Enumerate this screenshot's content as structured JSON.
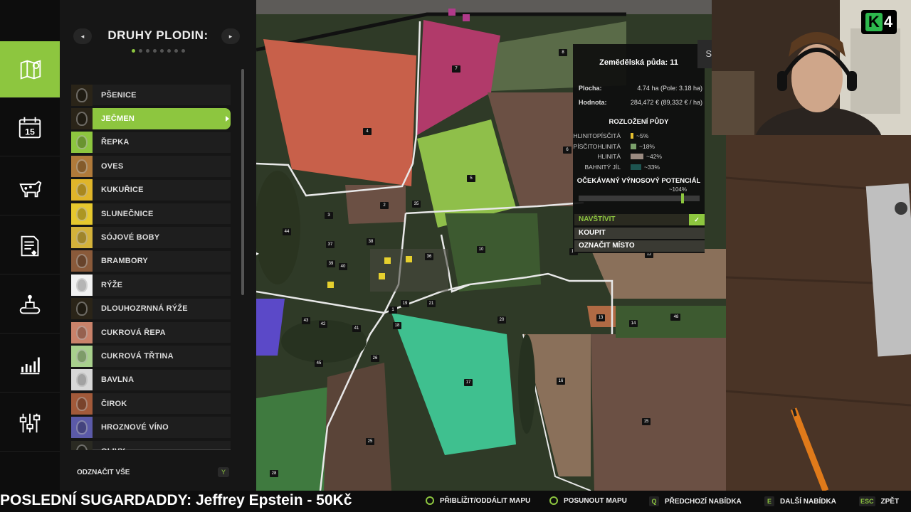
{
  "rail": {
    "items": [
      {
        "name": "map-icon",
        "active": true
      },
      {
        "name": "calendar-icon",
        "day": "15"
      },
      {
        "name": "animals-icon"
      },
      {
        "name": "contracts-icon"
      },
      {
        "name": "production-icon"
      },
      {
        "name": "statistics-icon"
      },
      {
        "name": "settings-icon"
      }
    ]
  },
  "panel": {
    "title": "DRUHY PLODIN:",
    "prev": "◂",
    "next": "▸",
    "page_count": 8,
    "active_page": 1,
    "crops": [
      {
        "label": "PŠENICE",
        "color": "#2a2418"
      },
      {
        "label": "JEČMEN",
        "color": "#2a2418",
        "selected": true
      },
      {
        "label": "ŘEPKA",
        "color": "#8dc63f"
      },
      {
        "label": "OVES",
        "color": "#b07a3a"
      },
      {
        "label": "KUKUŘICE",
        "color": "#e0b52a"
      },
      {
        "label": "SLUNEČNICE",
        "color": "#e6c82e"
      },
      {
        "label": "SÓJOVÉ BOBY",
        "color": "#d4b23a"
      },
      {
        "label": "BRAMBORY",
        "color": "#8a5a3a"
      },
      {
        "label": "RÝŽE",
        "color": "#f2f2f2"
      },
      {
        "label": "DLOUHOZRNNÁ RÝŽE",
        "color": "#2a2418"
      },
      {
        "label": "CUKROVÁ ŘEPA",
        "color": "#c9826a"
      },
      {
        "label": "CUKROVÁ TŘTINA",
        "color": "#a8d08d"
      },
      {
        "label": "BAVLNA",
        "color": "#d8d8d8"
      },
      {
        "label": "ČIROK",
        "color": "#a25a3a"
      },
      {
        "label": "HROZNOVÉ VÍNO",
        "color": "#5b5aa8"
      },
      {
        "label": "OLIVY",
        "color": "#2a2a22"
      }
    ],
    "select_all": "ODZNAČIT VŠE",
    "select_all_key": "Y"
  },
  "map": {
    "collapse": "▸",
    "field_numbers": [
      "1",
      "2",
      "3",
      "4",
      "5",
      "6",
      "7",
      "8",
      "10",
      "11",
      "12",
      "13",
      "14",
      "15",
      "16",
      "17",
      "18",
      "19",
      "20",
      "21",
      "25",
      "26",
      "28",
      "30",
      "35",
      "36",
      "37",
      "38",
      "39",
      "40",
      "41",
      "42",
      "43",
      "44",
      "45",
      "48"
    ],
    "colors": {
      "rapeseed": "#c8604a",
      "beet": "#b13a6a",
      "grass": "#8fbf4a",
      "mint": "#3fc08f",
      "fallow": "#6b5044",
      "soil": "#8a705a",
      "purple": "#5b49c8"
    }
  },
  "popup": {
    "title": "Zemědělská půda: 11",
    "area_label": "Plocha:",
    "area_value": "4.74 ha (Pole: 3.18 ha)",
    "value_label": "Hodnota:",
    "value_value": "284,472 € (89,332 € / ha)",
    "soil_title": "ROZLOŽENÍ PŮDY",
    "soils": [
      {
        "name": "HLINITOPÍSČITÁ",
        "pct": "~5%",
        "color": "#e6c02e",
        "share": 0.05
      },
      {
        "name": "PÍSČITOHLINITÁ",
        "pct": "~18%",
        "color": "#7aa06a",
        "share": 0.18
      },
      {
        "name": "HLINITÁ",
        "pct": "~42%",
        "color": "#9a8a80",
        "share": 0.42
      },
      {
        "name": "BAHNITÝ JÍL",
        "pct": "~33%",
        "color": "#1d5450",
        "share": 0.33
      }
    ],
    "yield_title": "OČEKÁVANÝ VÝNOSOVÝ POTENCIÁL",
    "yield_value": "~104%",
    "yield_level": 1.04,
    "actions": {
      "visit": "NAVŠTÍVIT",
      "buy": "KOUPIT",
      "mark": "OZNAČIT MÍSTO"
    },
    "cut_label": "S"
  },
  "stream": {
    "logo": "K4",
    "ticker": "POSLEDNÍ SUGARDADDY: Jeffrey Epstein - 50Kč"
  },
  "bottom": {
    "zoom": "PŘIBLÍŽIT/ODDÁLIT MAPU",
    "pan": "POSUNOUT MAPU",
    "prev_key": "Q",
    "prev": "PŘEDCHOZÍ NABÍDKA",
    "next_key": "E",
    "next": "DALŠÍ NABÍDKA",
    "back_key": "ESC",
    "back": "ZPĚT"
  }
}
